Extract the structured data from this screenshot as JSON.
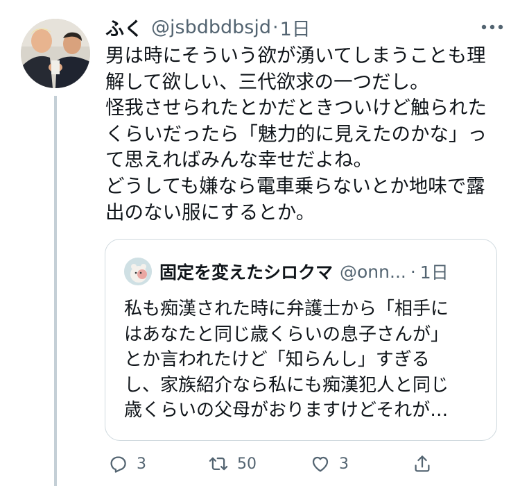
{
  "tweet": {
    "display_name": "ふく",
    "handle": "@jsbdbdbsjd",
    "separator": "·",
    "time": "1日",
    "text_lines": [
      "男は時にそういう欲が湧いてしまうことも理",
      "解して欲しい、三代欲求の一つだし。",
      "怪我させられたとかだときついけど触られた",
      "くらいだったら「魅力的に見えたのかな」っ",
      "て思えればみんな幸せだよね。",
      "どうしても嫌なら電車乗らないとか地味で露",
      "出のない服にするとか。"
    ]
  },
  "quote": {
    "display_name": "固定を変えたシロクマ",
    "handle": "@onn...",
    "separator": "·",
    "time": "1日",
    "text_lines": [
      "私も痴漢された時に弁護士から「相手に",
      "はあなたと同じ歳くらいの息子さんが」",
      "とか言われたけど「知らんし」すぎる",
      "し、家族紹介なら私にも痴漢犯人と同じ",
      "歳くらいの父母がおりますけどそれが…"
    ]
  },
  "actions": {
    "reply_count": "3",
    "retweet_count": "50",
    "like_count": "3"
  },
  "icons": {
    "reply": "reply-icon",
    "retweet": "retweet-icon",
    "like": "like-icon",
    "share": "share-icon",
    "more": "more-icon"
  },
  "colors": {
    "text": "#0f1419",
    "secondary": "#536471",
    "border": "#cfd9de",
    "thread_line": "#c4cfd6"
  }
}
